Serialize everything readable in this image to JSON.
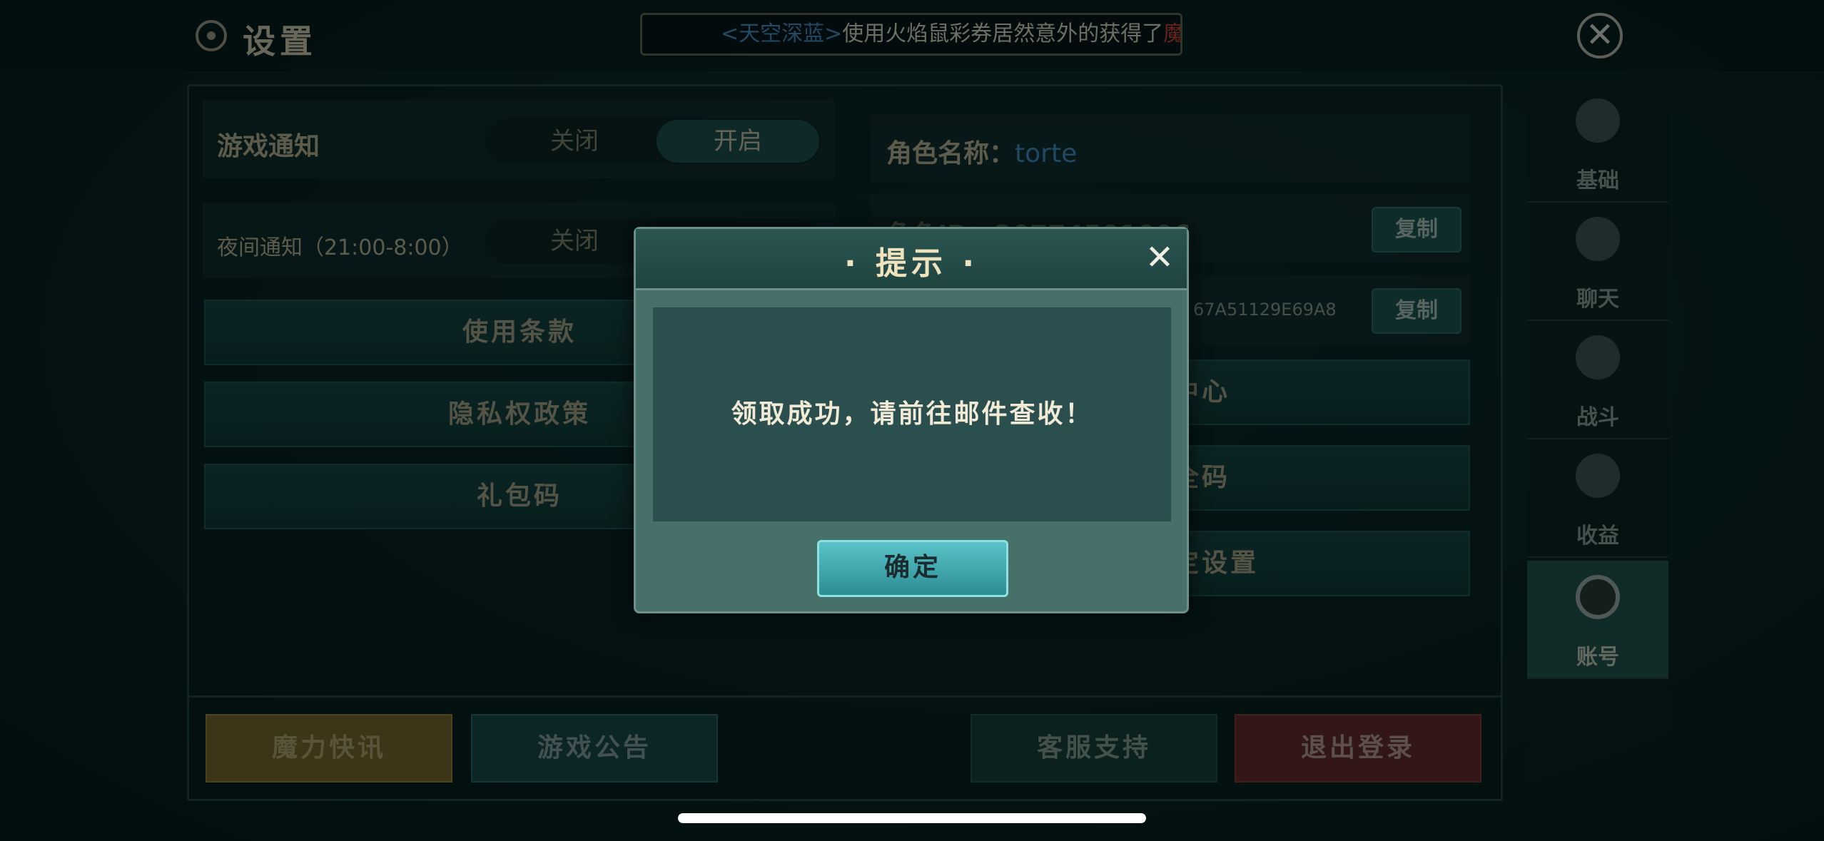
{
  "header": {
    "title": "设置",
    "ticker": {
      "name": "<天空深蓝>",
      "message": "使用火焰鼠彩券居然意外的获得了",
      "tail": "魔"
    }
  },
  "left": {
    "game_notify": {
      "label": "游戏通知",
      "off": "关闭",
      "on": "开启",
      "state": "开启"
    },
    "night_notify": {
      "label": "夜间通知（21:00-8:00）",
      "off": "关闭"
    },
    "buttons": [
      "使用条款",
      "隐私权政策",
      "礼包码"
    ]
  },
  "right": {
    "role_name_label": "角色名称：",
    "role_name_value": "torte",
    "role_id_partial": "角色ID：20774501006",
    "code_partial": "67A51129E69A8",
    "copy": "复制",
    "partial_buttons": [
      "中心",
      "全码",
      "定设置"
    ]
  },
  "bottom": {
    "news": "魔力快讯",
    "notice": "游戏公告",
    "support": "客服支持",
    "logout": "退出登录"
  },
  "sidebar": [
    {
      "label": "基础",
      "icon": "gear-icon"
    },
    {
      "label": "聊天",
      "icon": "chat-icon"
    },
    {
      "label": "战斗",
      "icon": "sword-icon"
    },
    {
      "label": "收益",
      "icon": "coin-icon"
    },
    {
      "label": "账号",
      "icon": "account-icon",
      "active": true
    }
  ],
  "dialog": {
    "title": "提示",
    "message": "领取成功，请前往邮件查收！",
    "ok": "确定"
  },
  "colors": {
    "accent": "#5bc3c9",
    "gold": "#c9a233",
    "red": "#b53a3a"
  }
}
